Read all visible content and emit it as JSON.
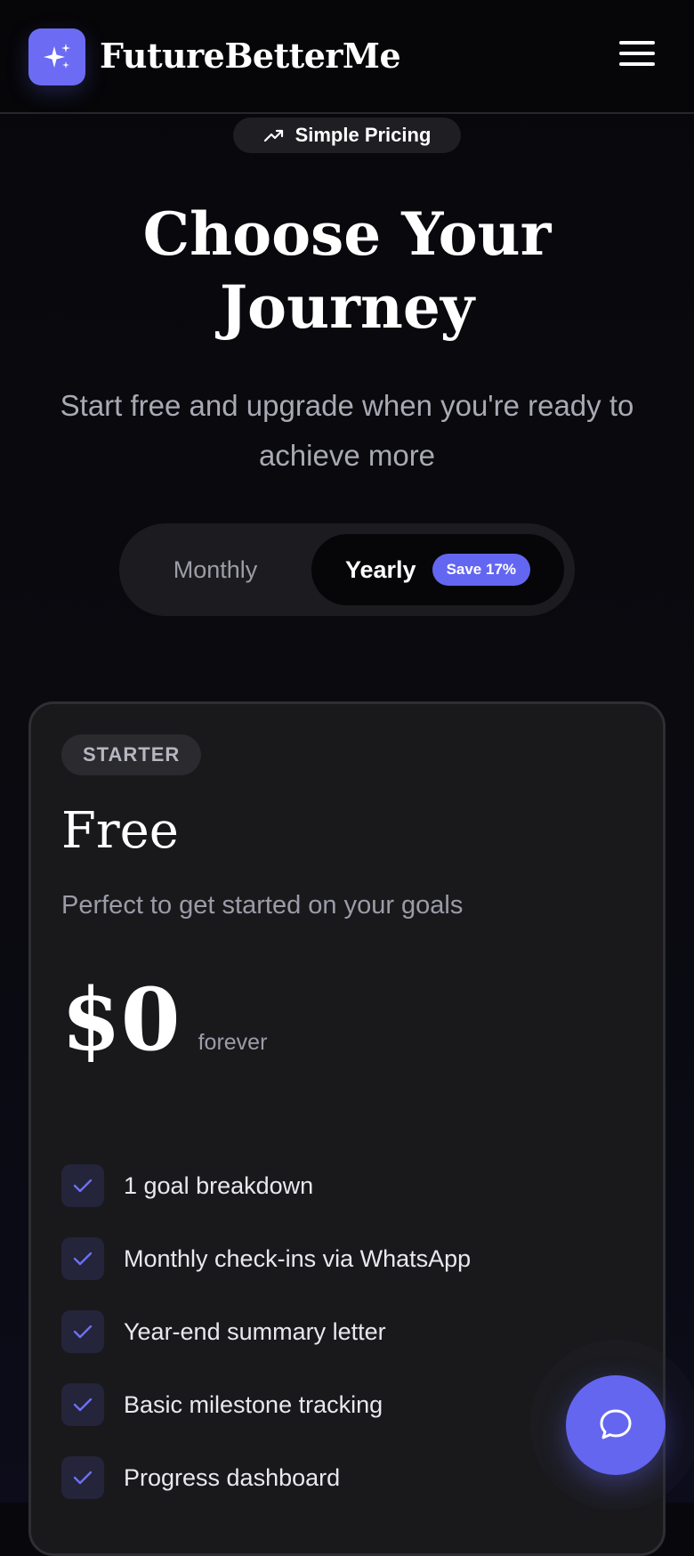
{
  "header": {
    "brand": "FutureBetterMe",
    "logo_icon": "sparkles-icon",
    "menu_icon": "hamburger-menu-icon"
  },
  "hero": {
    "pill_label": "Simple Pricing",
    "pill_icon": "trending-up-icon",
    "title_line1": "Choose Your",
    "title_line2": "Journey",
    "subtitle_line1": "Start free and upgrade when you're ready to",
    "subtitle_line2": "achieve more"
  },
  "billing_toggle": {
    "monthly_label": "Monthly",
    "yearly_label": "Yearly",
    "save_badge": "Save 17%",
    "selected": "Yearly"
  },
  "plan": {
    "tier": "STARTER",
    "name": "Free",
    "description": "Perfect to get started on your goals",
    "price": "$0",
    "period": "forever",
    "features": [
      "1 goal breakdown",
      "Monthly check-ins via WhatsApp",
      "Year-end summary letter",
      "Basic milestone tracking",
      "Progress dashboard"
    ]
  },
  "chat_button": {
    "icon": "chat-bubble-icon"
  },
  "colors": {
    "accent": "#6366f1",
    "background": "#08080c",
    "card": "#19191c",
    "muted_text": "#9c9ca8"
  }
}
